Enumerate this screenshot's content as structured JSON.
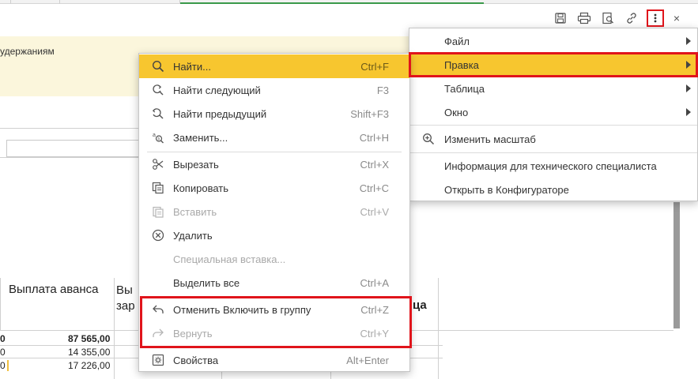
{
  "background": {
    "fragment_text": "удержаниям",
    "column_headers": [
      "Выплата аванса",
      "Вы",
      "зар",
      "ца"
    ],
    "rows": [
      {
        "left": "0",
        "value": "87 565,00"
      },
      {
        "left": "0",
        "value": "14 355,00"
      },
      {
        "left": "0",
        "value": "17 226,00"
      }
    ]
  },
  "toolbar": {
    "icons": [
      "save-icon",
      "print-icon",
      "preview-icon",
      "link-icon",
      "more-icon"
    ],
    "close": "×"
  },
  "main_menu": {
    "items": [
      {
        "label": "Файл",
        "submenu": true
      },
      {
        "label": "Правка",
        "submenu": true,
        "highlighted": true
      },
      {
        "label": "Таблица",
        "submenu": true
      },
      {
        "label": "Окно",
        "submenu": true
      },
      {
        "label": "Изменить масштаб",
        "icon": "zoom-icon"
      },
      {
        "label": "Информация для технического специалиста"
      },
      {
        "label": "Открыть в Конфигураторе"
      }
    ]
  },
  "edit_menu": {
    "items": [
      {
        "label": "Найти...",
        "shortcut": "Ctrl+F",
        "icon": "search-icon",
        "highlighted": true
      },
      {
        "label": "Найти следующий",
        "shortcut": "F3",
        "icon": "find-next-icon"
      },
      {
        "label": "Найти предыдущий",
        "shortcut": "Shift+F3",
        "icon": "find-previous-icon"
      },
      {
        "label": "Заменить...",
        "shortcut": "Ctrl+H",
        "icon": "replace-icon"
      },
      {
        "label": "Вырезать",
        "shortcut": "Ctrl+X",
        "icon": "scissors-icon"
      },
      {
        "label": "Копировать",
        "shortcut": "Ctrl+C",
        "icon": "copy-icon"
      },
      {
        "label": "Вставить",
        "shortcut": "Ctrl+V",
        "icon": "paste-icon",
        "disabled": true
      },
      {
        "label": "Удалить",
        "icon": "delete-icon"
      },
      {
        "label": "Специальная вставка...",
        "disabled": true
      },
      {
        "label": "Выделить все",
        "shortcut": "Ctrl+A"
      },
      {
        "label": "Отменить Включить в группу",
        "shortcut": "Ctrl+Z",
        "icon": "undo-icon"
      },
      {
        "label": "Вернуть",
        "shortcut": "Ctrl+Y",
        "icon": "redo-icon",
        "disabled": true
      },
      {
        "label": "Свойства",
        "shortcut": "Alt+Enter",
        "icon": "properties-icon"
      }
    ]
  },
  "colors": {
    "highlight": "#f7c62f",
    "annotation_red": "#e0141b",
    "yellow_band": "#fbf6dc"
  }
}
